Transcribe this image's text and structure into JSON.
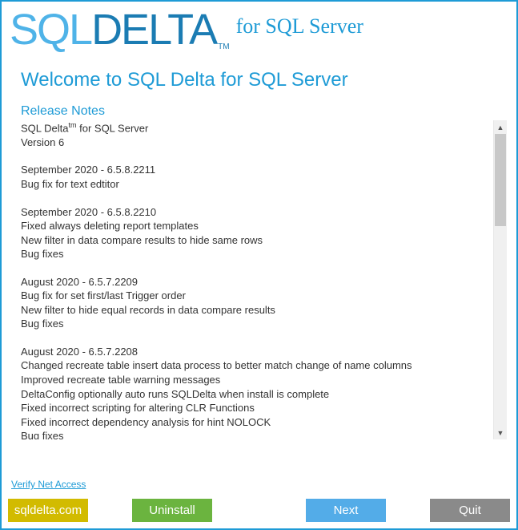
{
  "logo": {
    "sql": "SQL",
    "delta": "DELTA",
    "tm": "TM"
  },
  "tagline": "for SQL Server",
  "welcome": "Welcome to SQL Delta for SQL Server",
  "release_title": "Release Notes",
  "product": {
    "name_prefix": "SQL Delta",
    "tm": "tm",
    "name_suffix": " for SQL Server",
    "version": "Version 6"
  },
  "entries": [
    {
      "date": "September 2020 - 6.5.8.2211",
      "lines": [
        "Bug fix for text edtitor"
      ]
    },
    {
      "date": "September 2020 - 6.5.8.2210",
      "lines": [
        "Fixed always deleting report templates",
        "New filter in data compare results to hide same rows",
        "Bug fixes"
      ]
    },
    {
      "date": "August 2020 - 6.5.7.2209",
      "lines": [
        "Bug fix for set first/last Trigger order",
        "New filter to hide equal records in data compare results",
        "Bug fixes"
      ]
    },
    {
      "date": "August 2020 - 6.5.7.2208",
      "lines": [
        "Changed recreate table insert data process to better match change of name columns",
        "Improved recreate table warning messages",
        "DeltaConfig optionally auto runs SQLDelta when install is complete",
        "Fixed incorrect scripting for altering CLR Functions",
        "Fixed incorrect dependency analysis for hint NOLOCK",
        "Bug fixes"
      ]
    }
  ],
  "verify": "Verify Net Access",
  "footer": {
    "site": "sqldelta.com",
    "uninstall": "Uninstall",
    "next": "Next",
    "quit": "Quit"
  }
}
